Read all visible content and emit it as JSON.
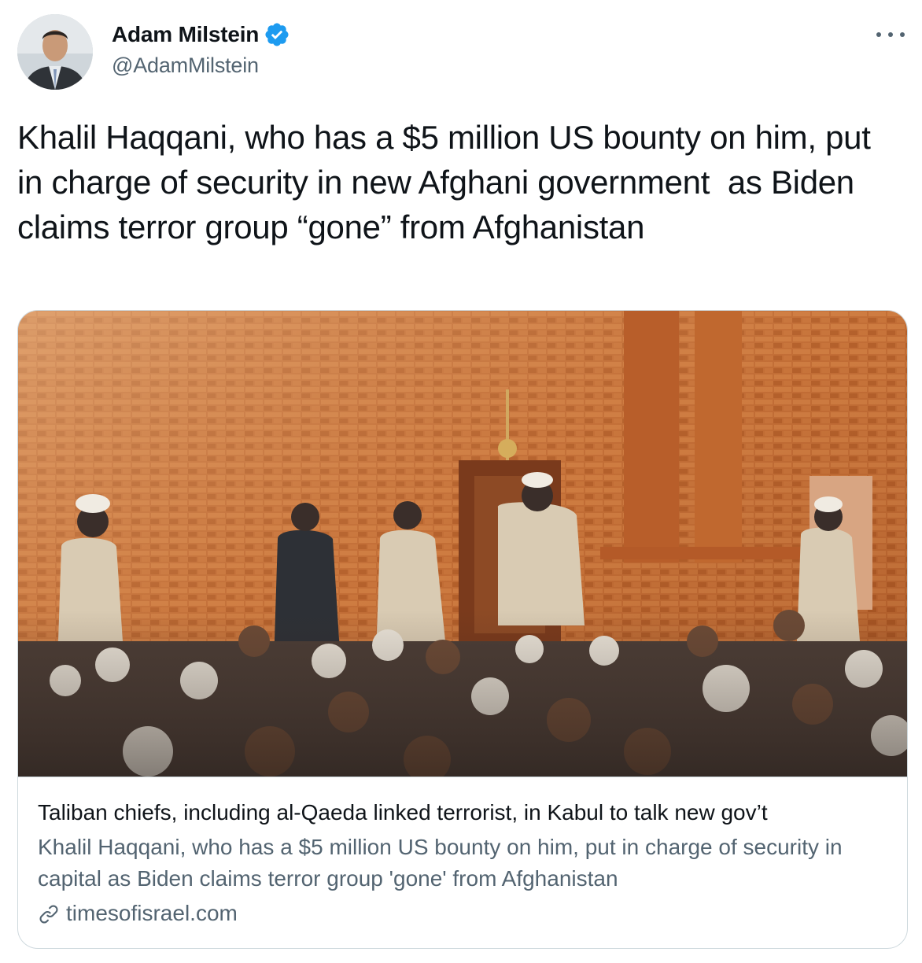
{
  "author": {
    "display_name": "Adam Milstein",
    "handle": "@AdamMilstein",
    "verified": true,
    "avatar_icon": "profile-photo"
  },
  "tweet": {
    "text": "Khalil Haqqani, who has a $5 million US bounty on him, put in charge of security in new Afghani government  as Biden claims terror group “gone” from Afghanistan"
  },
  "menu": {
    "icon": "more-horizontal-icon"
  },
  "card": {
    "title": "Taliban chiefs, including al-Qaeda linked terrorist, in Kabul to talk new gov’t",
    "description": "Khalil Haqqani, who has a $5 million US bounty on him, put in charge of security in capital as Biden claims terror group 'gone' from Afghanistan",
    "domain": "timesofisrael.com",
    "domain_icon": "link-icon"
  },
  "colors": {
    "text_primary": "#0f1419",
    "text_secondary": "#536471",
    "border": "#cfd9de",
    "verified_blue": "#1d9bf0"
  }
}
